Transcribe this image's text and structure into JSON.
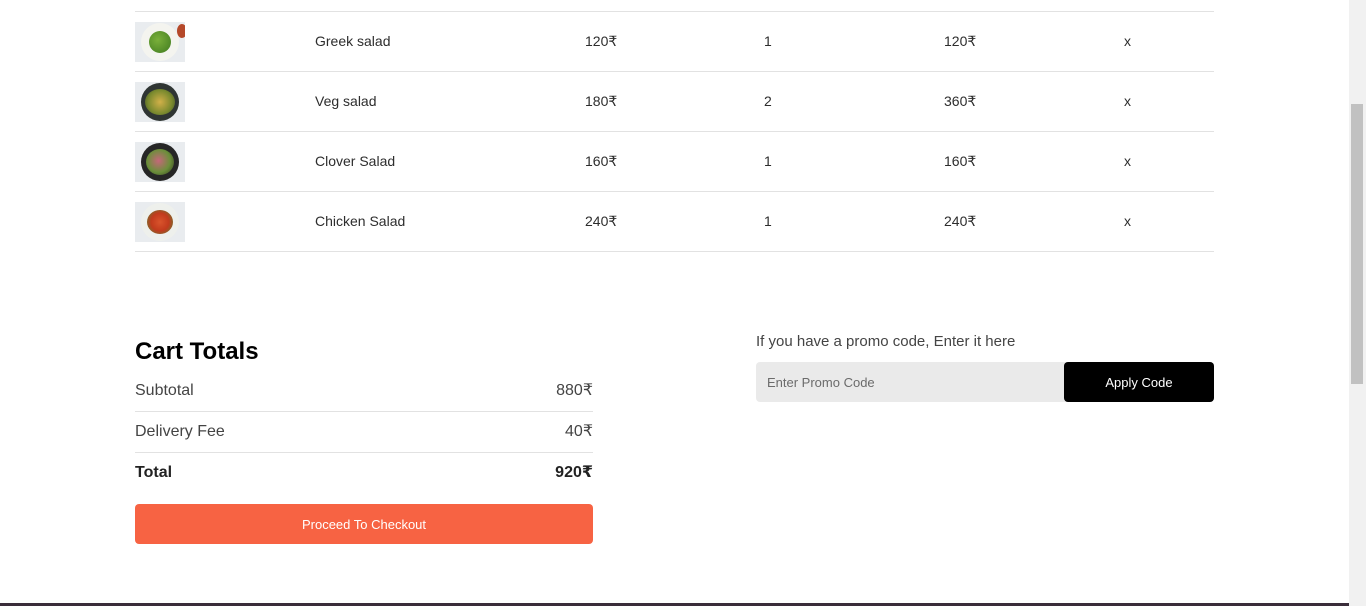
{
  "cart": {
    "items": [
      {
        "name": "Greek salad",
        "price": "120₹",
        "quantity": "1",
        "total": "120₹",
        "remove": "x",
        "image_icon": "greek-salad-image"
      },
      {
        "name": "Veg salad",
        "price": "180₹",
        "quantity": "2",
        "total": "360₹",
        "remove": "x",
        "image_icon": "veg-salad-image"
      },
      {
        "name": "Clover Salad",
        "price": "160₹",
        "quantity": "1",
        "total": "160₹",
        "remove": "x",
        "image_icon": "clover-salad-image"
      },
      {
        "name": "Chicken Salad",
        "price": "240₹",
        "quantity": "1",
        "total": "240₹",
        "remove": "x",
        "image_icon": "chicken-salad-image"
      }
    ]
  },
  "totals": {
    "title": "Cart Totals",
    "subtotal_label": "Subtotal",
    "subtotal_value": "880₹",
    "delivery_label": "Delivery Fee",
    "delivery_value": "40₹",
    "total_label": "Total",
    "total_value": "920₹",
    "checkout_label": "Proceed To Checkout"
  },
  "promo": {
    "prompt": "If you have a promo code, Enter it here",
    "placeholder": "Enter Promo Code",
    "value": "",
    "apply_label": "Apply Code"
  },
  "colors": {
    "accent": "#f76343",
    "apply_button": "#000000",
    "promo_input_bg": "#eaeaea"
  }
}
